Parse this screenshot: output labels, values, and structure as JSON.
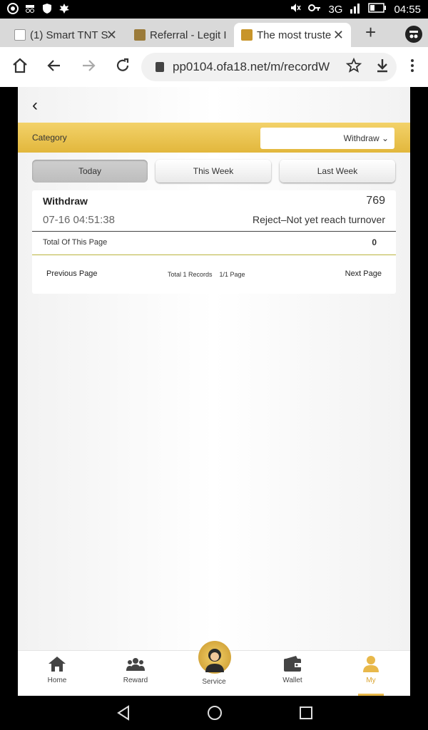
{
  "status_bar": {
    "time": "04:55",
    "network": "3G",
    "icons": [
      "chrome-icon",
      "incognito-icon",
      "shield-icon",
      "maple-leaf-icon",
      "mute-icon",
      "key-icon",
      "signal-icon",
      "battery-icon"
    ]
  },
  "browser": {
    "tabs": [
      {
        "label": "(1) Smart TNT S",
        "close": "✕"
      },
      {
        "label": "Referral - Legit I",
        "close": ""
      },
      {
        "label": "The most truste",
        "close": "✕"
      }
    ],
    "new_tab": "+",
    "url": "pp0104.ofa18.net/m/recordW"
  },
  "page": {
    "back": "‹",
    "category_label": "Category",
    "category_value": "Withdraw ⌄",
    "filters": [
      "Today",
      "This Week",
      "Last Week"
    ],
    "record": {
      "type": "Withdraw",
      "amount": "769",
      "time": "07-16 04:51:38",
      "status": "Reject–Not yet reach turnover"
    },
    "total_label": "Total Of This Page",
    "total_value": "0",
    "pagination": {
      "prev": "Previous Page",
      "info": "Total 1 Records    1/1 Page",
      "next": "Next Page"
    }
  },
  "bottom_nav": {
    "items": [
      "Home",
      "Reward",
      "Service",
      "Wallet",
      "My"
    ],
    "active": "My",
    "accent": "#d9a22b"
  },
  "colors": {
    "gold_bar_top": "#f3d26a",
    "gold_bar_bottom": "#e2b73c"
  }
}
